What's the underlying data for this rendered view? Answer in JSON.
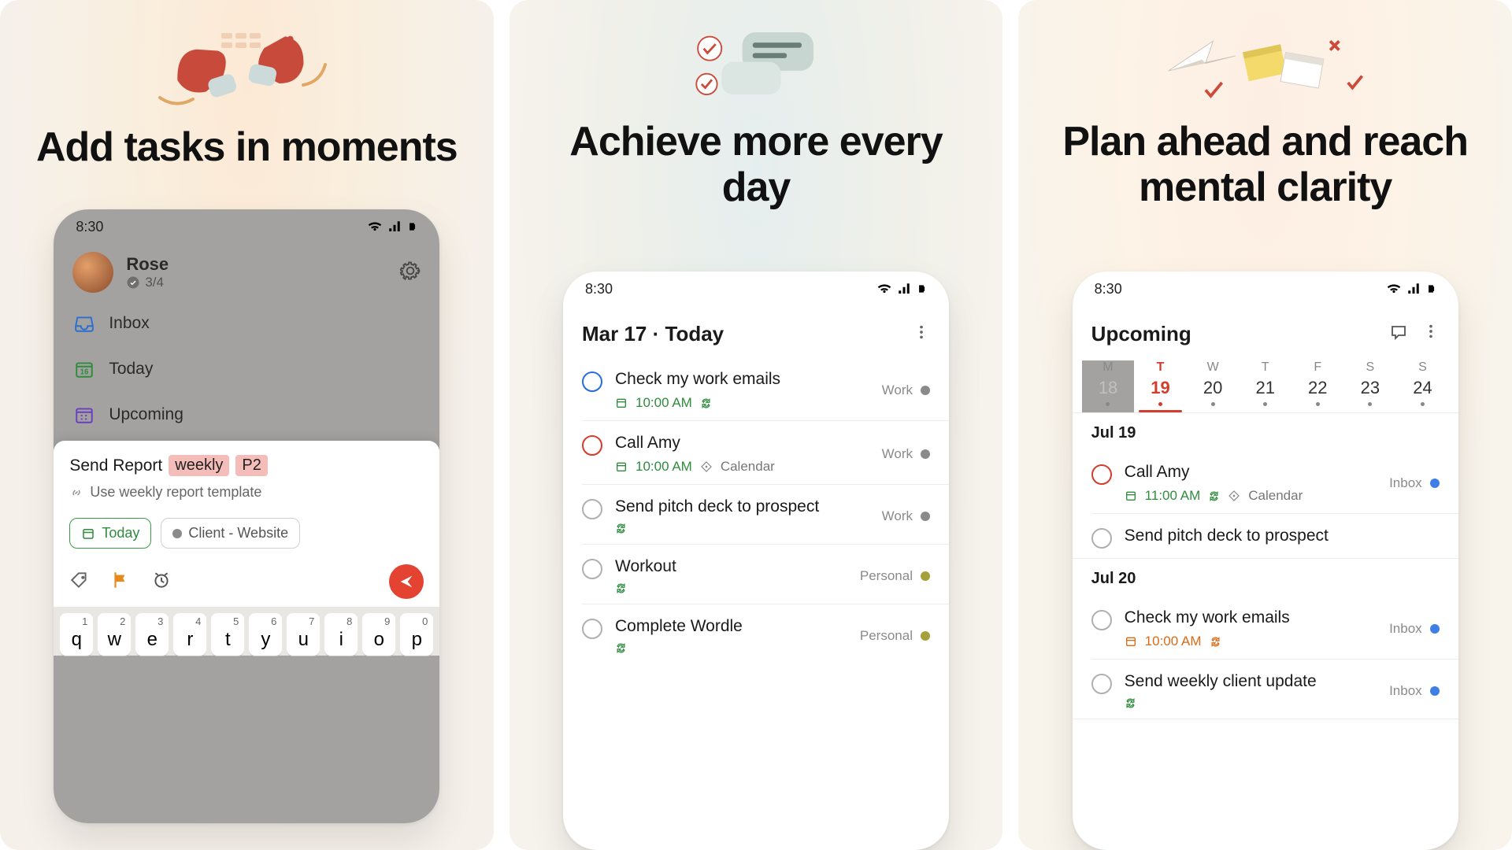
{
  "panels": [
    {
      "tagline": "Add tasks in moments"
    },
    {
      "tagline": "Achieve more every day"
    },
    {
      "tagline": "Plan ahead and reach mental clarity"
    }
  ],
  "status_time": "8:30",
  "panel1": {
    "user_name": "Rose",
    "user_progress": "3/4",
    "nav": {
      "inbox": "Inbox",
      "today": "Today",
      "upcoming": "Upcoming"
    },
    "quickadd": {
      "text": "Send Report",
      "tag_weekly": "weekly",
      "tag_p2": "P2",
      "subtask_link": "Use weekly report template",
      "chip_today": "Today",
      "chip_project": "Client - Website"
    },
    "keyboard": {
      "row": [
        {
          "n": "1",
          "l": "q"
        },
        {
          "n": "2",
          "l": "w"
        },
        {
          "n": "3",
          "l": "e"
        },
        {
          "n": "4",
          "l": "r"
        },
        {
          "n": "5",
          "l": "t"
        },
        {
          "n": "6",
          "l": "y"
        },
        {
          "n": "7",
          "l": "u"
        },
        {
          "n": "8",
          "l": "i"
        },
        {
          "n": "9",
          "l": "o"
        },
        {
          "n": "0",
          "l": "p"
        }
      ]
    }
  },
  "panel2": {
    "title": "Mar 17 · Today",
    "tasks": [
      {
        "title": "Check my work emails",
        "time": "10:00 AM",
        "recurring": true,
        "project": "Work",
        "dotcolor": "grey",
        "priority": "blue",
        "show_cal": true
      },
      {
        "title": "Call Amy",
        "time": "10:00 AM",
        "calendar_tag": "Calendar",
        "project": "Work",
        "dotcolor": "grey",
        "priority": "red",
        "show_cal": true
      },
      {
        "title": "Send pitch deck to prospect",
        "recurring": true,
        "project": "Work",
        "dotcolor": "grey"
      },
      {
        "title": "Workout",
        "recurring": true,
        "project": "Personal",
        "dotcolor": "olive"
      },
      {
        "title": "Complete Wordle",
        "recurring": true,
        "project": "Personal",
        "dotcolor": "olive"
      }
    ]
  },
  "panel3": {
    "title": "Upcoming",
    "week": [
      {
        "dw": "M",
        "dn": "18",
        "dim": true
      },
      {
        "dw": "T",
        "dn": "19",
        "sel": true
      },
      {
        "dw": "W",
        "dn": "20"
      },
      {
        "dw": "T",
        "dn": "21"
      },
      {
        "dw": "F",
        "dn": "22"
      },
      {
        "dw": "S",
        "dn": "23"
      },
      {
        "dw": "S",
        "dn": "24"
      }
    ],
    "sections": [
      {
        "label": "Jul 19",
        "tasks": [
          {
            "title": "Call Amy",
            "time": "11:00 AM",
            "time_color": "green",
            "recurring": true,
            "calendar_tag": "Calendar",
            "project": "Inbox",
            "dotcolor": "blue",
            "priority": "red",
            "show_cal": true
          },
          {
            "title": "Send pitch deck to prospect"
          }
        ]
      },
      {
        "label": "Jul 20",
        "tasks": [
          {
            "title": "Check my work emails",
            "time": "10:00 AM",
            "time_color": "orange",
            "recurring": true,
            "project": "Inbox",
            "dotcolor": "blue",
            "show_cal": true
          },
          {
            "title": "Send weekly client update",
            "recurring": true,
            "project": "Inbox",
            "dotcolor": "blue"
          }
        ]
      }
    ]
  }
}
